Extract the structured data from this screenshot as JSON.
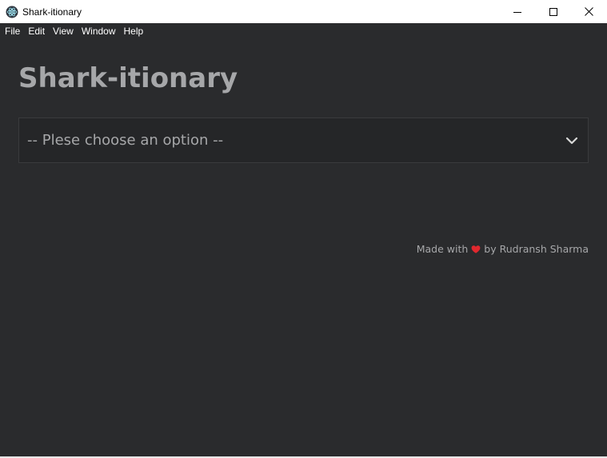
{
  "window": {
    "title": "Shark-itionary",
    "icon": "electron-atom-icon"
  },
  "menu": {
    "items": [
      "File",
      "Edit",
      "View",
      "Window",
      "Help"
    ]
  },
  "main": {
    "title": "Shark-itionary",
    "select": {
      "selected_label": "-- Plese choose an option --"
    },
    "footer": {
      "prefix": "Made with",
      "heart_color": "#e0282e",
      "suffix": "by Rudransh Sharma"
    }
  },
  "colors": {
    "background": "#2a2b2d",
    "title_text": "#a6a7a9",
    "select_bg": "#252628"
  }
}
